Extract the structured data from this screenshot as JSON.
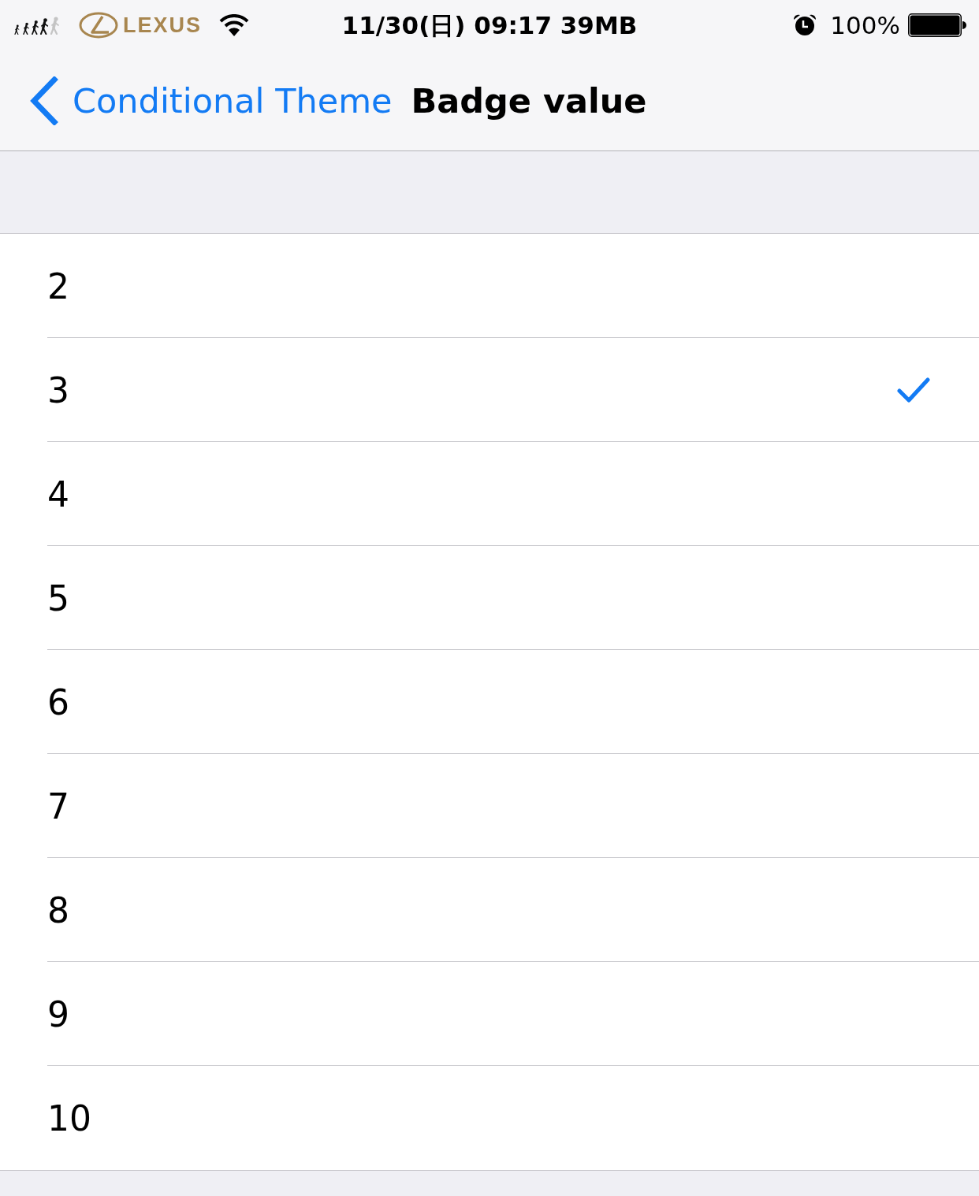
{
  "status_bar": {
    "carrier": "LEXUS",
    "datetime": "11/30(日) 09:17 39MB",
    "battery_percent": "100%"
  },
  "nav_bar": {
    "back_label": "Conditional Theme",
    "title": "Badge value"
  },
  "options": [
    {
      "label": "2",
      "selected": false
    },
    {
      "label": "3",
      "selected": true
    },
    {
      "label": "4",
      "selected": false
    },
    {
      "label": "5",
      "selected": false
    },
    {
      "label": "6",
      "selected": false
    },
    {
      "label": "7",
      "selected": false
    },
    {
      "label": "8",
      "selected": false
    },
    {
      "label": "9",
      "selected": false
    },
    {
      "label": "10",
      "selected": false
    }
  ]
}
